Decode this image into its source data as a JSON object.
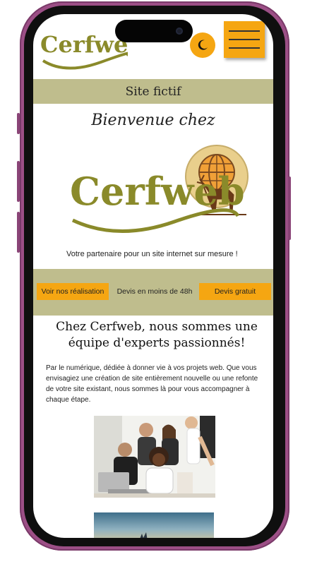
{
  "header": {
    "logo_text": "Cerfweb",
    "theme_toggle_icon": "moon-icon",
    "menu_icon": "hamburger-icon"
  },
  "banner": {
    "title": "Site fictif"
  },
  "hero": {
    "welcome": "Bienvenue chez",
    "logo_text": "Cerfweb",
    "globe_icon": "globe-icon",
    "deer_icon": "deer-icon",
    "tagline": "Votre partenaire pour un site internet sur mesure !"
  },
  "cta": {
    "realisations_label": "Voir nos réalisation",
    "middle_text": "Devis en moins de 48h",
    "devis_label": "Devis gratuit"
  },
  "intro": {
    "title": "Chez Cerfweb, nous sommes une équipe d'experts passionnés!",
    "text": "Par le numérique, dédiée à donner vie à vos projets web. Que vous envisagiez une création de site entièrement nouvelle ou une refonte de votre site existant, nous sommes là pour vous accompagner à chaque étape."
  },
  "colors": {
    "accent": "#f5a612",
    "band": "#bfbd8d",
    "logo_olive": "#8a8a2a",
    "phone_frame": "#9c4f86"
  }
}
